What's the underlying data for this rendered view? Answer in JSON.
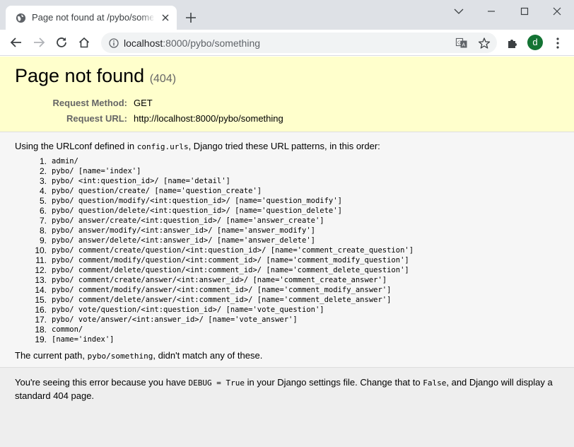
{
  "browser": {
    "tab_title": "Page not found at /pybo/something",
    "url_host": "localhost",
    "url_rest": ":8000/pybo/something",
    "profile_initial": "d",
    "profile_color": "#137333"
  },
  "page": {
    "title": "Page not found",
    "code": "(404)",
    "request_method_label": "Request Method:",
    "request_method_value": "GET",
    "request_url_label": "Request URL:",
    "request_url_value": "http://localhost:8000/pybo/something",
    "intro_prefix": "Using the URLconf defined in ",
    "intro_module": "config.urls",
    "intro_suffix": ", Django tried these URL patterns, in this order:",
    "patterns": [
      {
        "num": "1.",
        "text": "admin/"
      },
      {
        "num": "2.",
        "text": "pybo/ [name='index']"
      },
      {
        "num": "3.",
        "text": "pybo/ <int:question_id>/ [name='detail']"
      },
      {
        "num": "4.",
        "text": "pybo/ question/create/ [name='question_create']"
      },
      {
        "num": "5.",
        "text": "pybo/ question/modify/<int:question_id>/ [name='question_modify']"
      },
      {
        "num": "6.",
        "text": "pybo/ question/delete/<int:question_id>/ [name='question_delete']"
      },
      {
        "num": "7.",
        "text": "pybo/ answer/create/<int:question_id>/ [name='answer_create']"
      },
      {
        "num": "8.",
        "text": "pybo/ answer/modify/<int:answer_id>/ [name='answer_modify']"
      },
      {
        "num": "9.",
        "text": "pybo/ answer/delete/<int:answer_id>/ [name='answer_delete']"
      },
      {
        "num": "10.",
        "text": "pybo/ comment/create/question/<int:question_id>/ [name='comment_create_question']"
      },
      {
        "num": "11.",
        "text": "pybo/ comment/modify/question/<int:comment_id>/ [name='comment_modify_question']"
      },
      {
        "num": "12.",
        "text": "pybo/ comment/delete/question/<int:comment_id>/ [name='comment_delete_question']"
      },
      {
        "num": "13.",
        "text": "pybo/ comment/create/answer/<int:answer_id>/ [name='comment_create_answer']"
      },
      {
        "num": "14.",
        "text": "pybo/ comment/modify/answer/<int:comment_id>/ [name='comment_modify_answer']"
      },
      {
        "num": "15.",
        "text": "pybo/ comment/delete/answer/<int:comment_id>/ [name='comment_delete_answer']"
      },
      {
        "num": "16.",
        "text": "pybo/ vote/question/<int:question_id>/ [name='vote_question']"
      },
      {
        "num": "17.",
        "text": "pybo/ vote/answer/<int:answer_id>/ [name='vote_answer']"
      },
      {
        "num": "18.",
        "text": "common/"
      },
      {
        "num": "19.",
        "text": "[name='index']"
      }
    ],
    "footer_prefix": "The current path, ",
    "footer_path": "pybo/something",
    "footer_suffix": ", didn't match any of these.",
    "explain_1": "You're seeing this error because you have ",
    "explain_code_1": "DEBUG = True",
    "explain_2": " in your Django settings file. Change that to ",
    "explain_code_2": "False",
    "explain_3": ", and Django will display a standard 404 page."
  }
}
